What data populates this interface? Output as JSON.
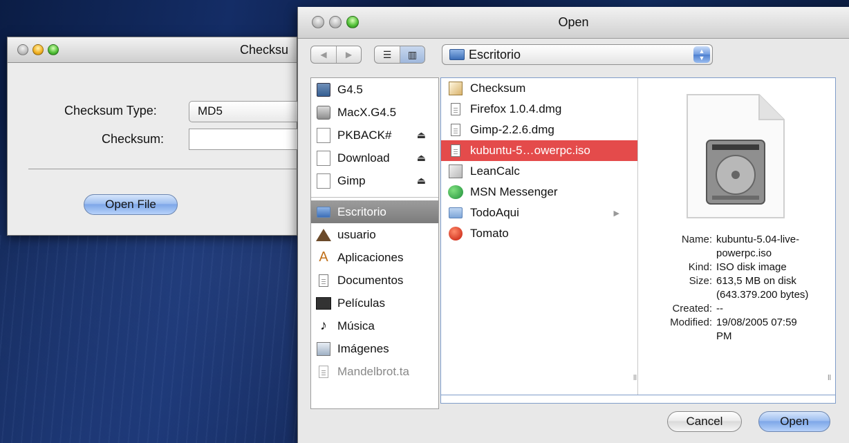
{
  "checksum_window": {
    "title": "Checksu",
    "type_label": "Checksum Type:",
    "type_value": "MD5",
    "checksum_label": "Checksum:",
    "checksum_value": "",
    "open_file_label": "Open File"
  },
  "open_dialog": {
    "title": "Open",
    "location": "Escritorio",
    "sidebar": {
      "devices": [
        {
          "label": "G4.5",
          "icon": "computer-icon",
          "eject": false
        },
        {
          "label": "MacX.G4.5",
          "icon": "hard-drive-icon",
          "eject": false
        },
        {
          "label": "PKBACK#",
          "icon": "disk-icon",
          "eject": true
        },
        {
          "label": "Download",
          "icon": "disk-icon",
          "eject": true
        },
        {
          "label": "Gimp",
          "icon": "disk-icon",
          "eject": true
        }
      ],
      "places": [
        {
          "label": "Escritorio",
          "icon": "desktop-folder-icon",
          "selected": true
        },
        {
          "label": "usuario",
          "icon": "home-icon"
        },
        {
          "label": "Aplicaciones",
          "icon": "applications-icon"
        },
        {
          "label": "Documentos",
          "icon": "documents-icon"
        },
        {
          "label": "Películas",
          "icon": "movies-icon"
        },
        {
          "label": "Música",
          "icon": "music-icon"
        },
        {
          "label": "Imágenes",
          "icon": "pictures-icon"
        },
        {
          "label": "Mandelbrot.ta",
          "icon": "archive-icon",
          "dimmed": true
        }
      ],
      "eject_glyph": "⏏"
    },
    "files": [
      {
        "label": "Checksum",
        "icon": "app-icon"
      },
      {
        "label": "Firefox 1.0.4.dmg",
        "icon": "document-icon"
      },
      {
        "label": "Gimp-2.2.6.dmg",
        "icon": "document-icon"
      },
      {
        "label": "kubuntu-5…owerpc.iso",
        "icon": "document-icon",
        "selected": true
      },
      {
        "label": "LeanCalc",
        "icon": "calculator-icon"
      },
      {
        "label": "MSN Messenger",
        "icon": "msn-icon"
      },
      {
        "label": "TodoAqui",
        "icon": "folder-icon",
        "has_children": true
      },
      {
        "label": "Tomato",
        "icon": "tomato-icon"
      }
    ],
    "info": {
      "name_key": "Name:",
      "name_value_line1": "kubuntu-5.04-live-",
      "name_value_line2": "powerpc.iso",
      "kind_key": "Kind:",
      "kind_value": "ISO disk image",
      "size_key": "Size:",
      "size_value_line1": "613,5 MB on disk",
      "size_value_line2": "(643.379.200 bytes)",
      "created_key": "Created:",
      "created_value": "--",
      "modified_key": "Modified:",
      "modified_value_line1": "19/08/2005 07:59",
      "modified_value_line2": "PM"
    },
    "cancel_label": "Cancel",
    "open_label": "Open",
    "colors": {
      "selection": "#e44b4b",
      "accent": "#7ea7e8"
    }
  }
}
